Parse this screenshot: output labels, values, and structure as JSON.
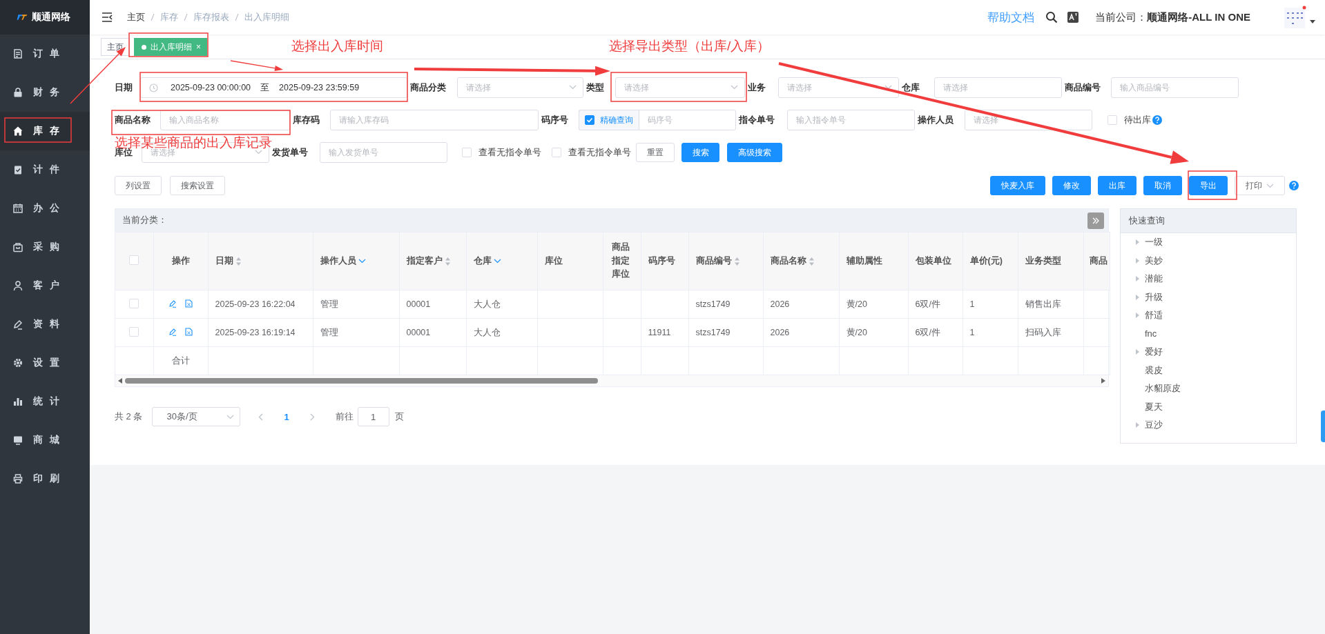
{
  "logo": {
    "text": "顺通网络"
  },
  "sidebar": {
    "items": [
      {
        "label": "订单",
        "selected": false
      },
      {
        "label": "财务",
        "selected": false
      },
      {
        "label": "库存",
        "selected": true
      },
      {
        "label": "计件",
        "selected": false
      },
      {
        "label": "办公",
        "selected": false
      },
      {
        "label": "采购",
        "selected": false
      },
      {
        "label": "客户",
        "selected": false
      },
      {
        "label": "资料",
        "selected": false
      },
      {
        "label": "设置",
        "selected": false
      },
      {
        "label": "统计",
        "selected": false
      },
      {
        "label": "商城",
        "selected": false
      },
      {
        "label": "印刷",
        "selected": false
      }
    ]
  },
  "header": {
    "breadcrumb": [
      "主页",
      "库存",
      "库存报表",
      "出入库明细"
    ],
    "help": "帮助文档",
    "company_label": "当前公司：",
    "company": "顺通网络-ALL IN ONE"
  },
  "tabs": [
    {
      "label": "主页",
      "selected": false
    },
    {
      "label": "出入库明细",
      "selected": true,
      "close": "×"
    }
  ],
  "filters": {
    "fields": [
      {
        "kind": "daterange",
        "label": "日期",
        "start": "2025-09-23 00:00:00",
        "separator": "至",
        "end": "2025-09-23 23:59:59"
      },
      {
        "kind": "select",
        "label": "商品分类",
        "placeholder": "请选择"
      },
      {
        "kind": "select",
        "label": "类型",
        "placeholder": "请选择"
      },
      {
        "kind": "select",
        "label": "业务",
        "placeholder": "请选择"
      },
      {
        "kind": "input",
        "label": "仓库",
        "placeholder": "请选择"
      },
      {
        "kind": "input",
        "label": "商品编号",
        "placeholder": "输入商品编号"
      },
      {
        "kind": "input",
        "label": "商品名称",
        "placeholder": "输入商品名称"
      },
      {
        "kind": "input",
        "label": "库存码",
        "placeholder": "请输入库存码"
      },
      {
        "kind": "checkinput",
        "label": "码序号",
        "check_label": "精确查询",
        "checked": true,
        "placeholder": "码序号"
      },
      {
        "kind": "input",
        "label": "指令单号",
        "placeholder": "输入指令单号"
      },
      {
        "kind": "input",
        "label": "操作人员",
        "placeholder": "请选择"
      },
      {
        "kind": "checkbox",
        "label": "待出库",
        "checked": false,
        "help": true
      },
      {
        "kind": "select",
        "label": "库位",
        "placeholder": "请选择"
      },
      {
        "kind": "input",
        "label": "发货单号",
        "placeholder": "输入发货单号"
      },
      {
        "kind": "checkbox",
        "label": "查看无指令单号",
        "checked": false,
        "help": false
      },
      {
        "kind": "checkbox",
        "label": "查看无指令单号",
        "checked": false,
        "help": false
      },
      {
        "kind": "button",
        "label": "重置",
        "primary": false
      },
      {
        "kind": "button",
        "label": "搜索",
        "primary": true
      },
      {
        "kind": "button",
        "label": "高级搜索",
        "primary": true
      }
    ]
  },
  "toolbar": {
    "left": [
      {
        "label": "列设置",
        "primary": false
      },
      {
        "label": "搜索设置",
        "primary": false
      }
    ],
    "right": [
      {
        "label": "快麦入库",
        "primary": true
      },
      {
        "label": "修改",
        "primary": true
      },
      {
        "label": "出库",
        "primary": true
      },
      {
        "label": "取消",
        "primary": true
      },
      {
        "label": "导出",
        "primary": true
      },
      {
        "label": "打印",
        "primary": false,
        "dropdown": true
      }
    ],
    "help": true
  },
  "table": {
    "category_label": "当前分类：",
    "header_checked": false,
    "columns": [
      {
        "label": "操作",
        "kind": "actions"
      },
      {
        "label": "日期",
        "kind": "sortable"
      },
      {
        "label": "操作人员",
        "kind": "filterable"
      },
      {
        "label": "指定客户",
        "kind": "sortable"
      },
      {
        "label": "仓库",
        "kind": "filterable"
      },
      {
        "label": "库位",
        "kind": "plain"
      },
      {
        "label": "商品指定库位",
        "kind": "plain"
      },
      {
        "label": "码序号",
        "kind": "plain"
      },
      {
        "label": "商品编号",
        "kind": "sortable"
      },
      {
        "label": "商品名称",
        "kind": "sortable"
      },
      {
        "label": "辅助属性",
        "kind": "plain"
      },
      {
        "label": "包装单位",
        "kind": "plain"
      },
      {
        "label": "单价(元)",
        "kind": "plain"
      },
      {
        "label": "业务类型",
        "kind": "plain"
      },
      {
        "label": "商品",
        "kind": "plain"
      }
    ],
    "rows": [
      {
        "kind": "data",
        "checked": false,
        "cells": [
          null,
          "2025-09-23 16:22:04",
          "管理",
          "00001",
          "大人仓",
          null,
          null,
          null,
          "stzs1749",
          "2026",
          "黄/20",
          "6双/件",
          "1",
          "销售出库",
          null
        ]
      },
      {
        "kind": "data",
        "checked": false,
        "cells": [
          null,
          "2025-09-23 16:19:14",
          "管理",
          "00001",
          "大人仓",
          null,
          null,
          "11911",
          "stzs1749",
          "2026",
          "黄/20",
          "6双/件",
          "1",
          "扫码入库",
          null
        ]
      },
      {
        "kind": "summary",
        "cells": [
          "合计",
          null,
          null,
          null,
          null,
          null,
          null,
          null,
          null,
          null,
          null,
          null,
          null,
          null,
          null
        ]
      }
    ]
  },
  "pagination": {
    "total": "共 2 条",
    "page_size": "30条/页",
    "pages": [
      {
        "label": "1",
        "selected": true
      }
    ],
    "goto_label": "前往",
    "goto_value": "1",
    "goto_suffix": "页"
  },
  "quick_query": {
    "title": "快速查询",
    "items": [
      {
        "label": "一级",
        "kind": "branch"
      },
      {
        "label": "美妙",
        "kind": "branch"
      },
      {
        "label": "潜能",
        "kind": "branch"
      },
      {
        "label": "升级",
        "kind": "branch"
      },
      {
        "label": "舒适",
        "kind": "branch"
      },
      {
        "label": "fnc",
        "kind": "leaf"
      },
      {
        "label": "爱好",
        "kind": "branch"
      },
      {
        "label": "裘皮",
        "kind": "leaf"
      },
      {
        "label": "水貂原皮",
        "kind": "leaf"
      },
      {
        "label": "夏天",
        "kind": "leaf"
      },
      {
        "label": "豆沙",
        "kind": "branch"
      }
    ]
  },
  "annotations": {
    "texts": [
      "选择出入库时间",
      "选择导出类型（出库/入库）",
      "选择某些商品的出入库记录"
    ]
  }
}
